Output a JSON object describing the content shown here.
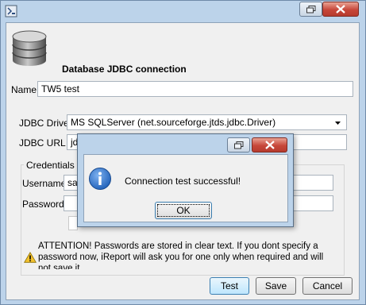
{
  "form": {
    "header_title": "Database JDBC connection",
    "name_label": "Name",
    "name_value": "TW5 test",
    "driver_label": "JDBC Driver",
    "driver_value": "MS SQLServer (net.sourceforge.jtds.jdbc.Driver)",
    "url_label": "JDBC URL",
    "url_value": "jd",
    "credentials_label": "Credentials",
    "username_label": "Username",
    "username_value": "sa",
    "password_label": "Password",
    "warning_text": "ATTENTION! Passwords are stored in clear text. If you dont specify a password now, iReport will ask you for one only when required and will not save it."
  },
  "buttons": {
    "test": "Test",
    "save": "Save",
    "cancel": "Cancel"
  },
  "dialog": {
    "message": "Connection test successful!",
    "ok": "OK"
  },
  "icons": {
    "app": "app-icon",
    "database": "database-icon",
    "restore": "restore-icon",
    "close": "close-icon",
    "warning": "warning-icon",
    "info": "info-icon",
    "dropdown": "chevron-down-icon"
  },
  "colors": {
    "frame": "#bcd3ea",
    "close_button": "#c7473a",
    "info_blue": "#1e5fb8",
    "warning_yellow": "#f2c12e"
  }
}
